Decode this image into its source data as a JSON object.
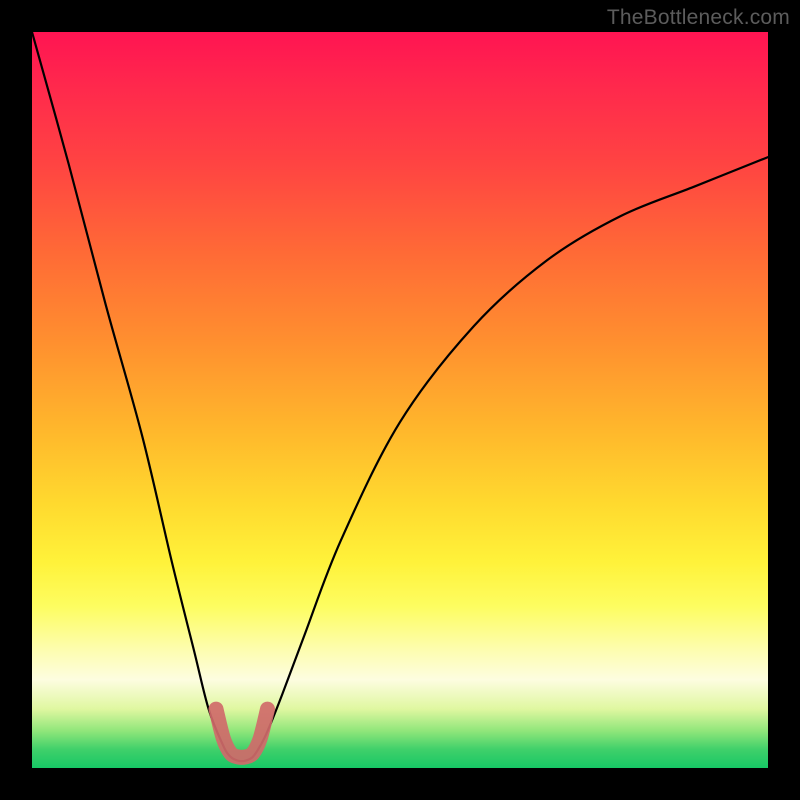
{
  "watermark": {
    "text": "TheBottleneck.com"
  },
  "chart_data": {
    "type": "line",
    "title": "",
    "xlabel": "",
    "ylabel": "",
    "xlim": [
      0,
      100
    ],
    "ylim": [
      0,
      100
    ],
    "series": [
      {
        "name": "bottleneck-curve",
        "x": [
          0,
          5,
          10,
          15,
          19,
          22,
          24,
          26,
          27,
          28,
          29,
          30,
          31,
          32,
          34,
          37,
          42,
          50,
          60,
          70,
          80,
          90,
          100
        ],
        "values": [
          100,
          82,
          63,
          45,
          28,
          16,
          8,
          3,
          1.5,
          1,
          1,
          1.5,
          3,
          5,
          10,
          18,
          31,
          47,
          60,
          69,
          75,
          79,
          83
        ]
      }
    ],
    "highlight": {
      "name": "optimum-marker",
      "x": [
        25,
        26,
        27,
        28,
        29,
        30,
        31,
        32
      ],
      "values": [
        8,
        4,
        2,
        1.5,
        1.5,
        2,
        4,
        8
      ],
      "color": "#d06a6a"
    }
  }
}
